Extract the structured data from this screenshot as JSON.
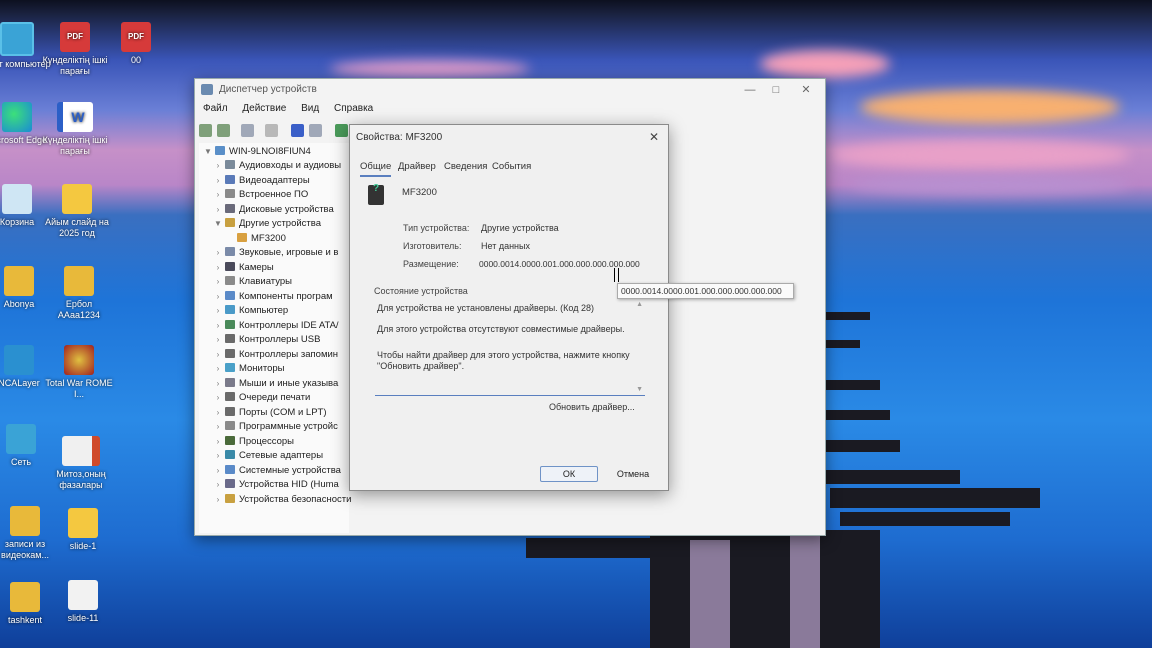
{
  "desktop": {
    "icons": [
      {
        "label": "Этот компьютер",
        "glyph": "monitor"
      },
      {
        "label": "Күнделіктің ішкі парағы",
        "glyph": "pdf"
      },
      {
        "label": "00",
        "glyph": "pdf"
      },
      {
        "label": "Microsoft Edge",
        "glyph": "edge"
      },
      {
        "label": "Күнделіктің ішкі парағы",
        "glyph": "word"
      },
      {
        "label": "Корзина",
        "glyph": "bin"
      },
      {
        "label": "Айым слайд на 2025 год",
        "glyph": "slide"
      },
      {
        "label": "Abonya",
        "glyph": "folder"
      },
      {
        "label": "Ербол ААаа1234",
        "glyph": "folder"
      },
      {
        "label": "NCALayer",
        "glyph": "nca"
      },
      {
        "label": "Total War ROME I...",
        "glyph": "game"
      },
      {
        "label": "Сеть",
        "glyph": "net"
      },
      {
        "label": "Митоз,оның фазалары",
        "glyph": "ppt"
      },
      {
        "label": "записи из видеокам...",
        "glyph": "folder"
      },
      {
        "label": "slide-1",
        "glyph": "slide"
      },
      {
        "label": "tashkent",
        "glyph": "folder"
      },
      {
        "label": "slide-11",
        "glyph": "paper"
      }
    ]
  },
  "devmgr": {
    "title": "Диспетчер устройств",
    "menu": [
      "Файл",
      "Действие",
      "Вид",
      "Справка"
    ],
    "tree_root": "WIN-9LNOI8FIUN4",
    "tree": [
      {
        "label": "Аудиовходы и аудиовы",
        "expanded": false
      },
      {
        "label": "Видеоадаптеры",
        "expanded": false
      },
      {
        "label": "Встроенное ПО",
        "expanded": false
      },
      {
        "label": "Дисковые устройства",
        "expanded": false
      },
      {
        "label": "Другие устройства",
        "expanded": true
      },
      {
        "label": "MF3200",
        "child": true
      },
      {
        "label": "Звуковые, игровые и в",
        "expanded": false
      },
      {
        "label": "Камеры",
        "expanded": false
      },
      {
        "label": "Клавиатуры",
        "expanded": false
      },
      {
        "label": "Компоненты програм",
        "expanded": false
      },
      {
        "label": "Компьютер",
        "expanded": false
      },
      {
        "label": "Контроллеры IDE ATA/",
        "expanded": false
      },
      {
        "label": "Контроллеры USB",
        "expanded": false
      },
      {
        "label": "Контроллеры запомин",
        "expanded": false
      },
      {
        "label": "Мониторы",
        "expanded": false
      },
      {
        "label": "Мыши и иные указыва",
        "expanded": false
      },
      {
        "label": "Очереди печати",
        "expanded": false
      },
      {
        "label": "Порты (COM и LPT)",
        "expanded": false
      },
      {
        "label": "Программные устройс",
        "expanded": false
      },
      {
        "label": "Процессоры",
        "expanded": false
      },
      {
        "label": "Сетевые адаптеры",
        "expanded": false
      },
      {
        "label": "Системные устройства",
        "expanded": false
      },
      {
        "label": "Устройства HID (Huma",
        "expanded": false
      },
      {
        "label": "Устройства безопасности",
        "expanded": false
      }
    ]
  },
  "props": {
    "title": "Свойства: MF3200",
    "tabs": [
      "Общие",
      "Драйвер",
      "Сведения",
      "События"
    ],
    "device_name": "MF3200",
    "type_label": "Тип устройства:",
    "type_value": "Другие устройства",
    "manufacturer_label": "Изготовитель:",
    "manufacturer_value": "Нет данных",
    "location_label": "Размещение:",
    "location_value": "0000.0014.0000.001.000.000.000.000.000",
    "status_label": "Состояние устройства",
    "status_line1": "Для устройства не установлены драйверы. (Код 28)",
    "status_line2": "Для этого устройства отсутствуют совместимые драйверы.",
    "status_line3": "Чтобы найти драйвер для этого устройства, нажмите кнопку \"Обновить драйвер\".",
    "update_button": "Обновить драйвер...",
    "ok_button": "ОК",
    "cancel_button": "Отмена",
    "tooltip": "0000.0014.0000.001.000.000.000.000.000"
  }
}
